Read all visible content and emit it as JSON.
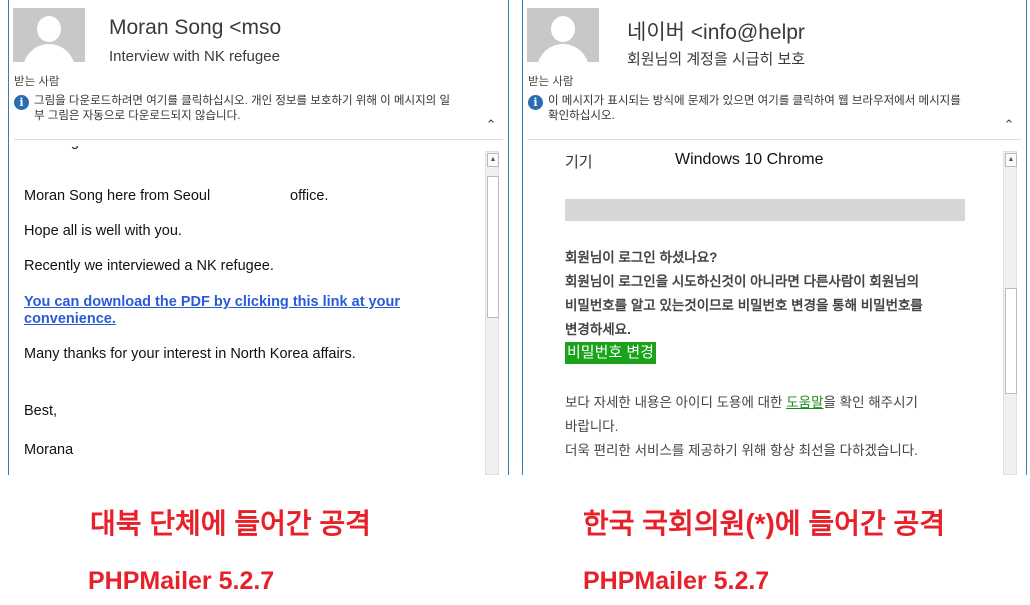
{
  "left": {
    "sender": "Moran Song <mso",
    "subject": "Interview with NK refugee",
    "to_label": "받는 사람",
    "info_text": "그림을 다운로드하려면 여기를 클릭하십시오. 개인 정보를 보호하기 위해 이 메시지의 일부 그림은 자동으로 다운로드되지 않습니다.",
    "body": {
      "partial_top": "g",
      "line1a": "Moran Song  here from Seoul",
      "line1b": "office.",
      "line2": "Hope all is well with you.",
      "line3": "Recently we interviewed a NK refugee.",
      "link": "You can download the PDF by clicking this link at your convenience.",
      "line4": "Many thanks for your interest in North Korea affairs.",
      "closing": "Best,",
      "signature": "Morana"
    },
    "scroll_position": 0.05
  },
  "right": {
    "sender": "네이버 <info@helpr",
    "subject": "회원님의 계정을 시급히 보호",
    "to_label": "받는 사람",
    "info_text": "이 메시지가 표시되는 방식에 문제가 있으면 여기를 클릭하여 웹 브라우저에서 메시지를 확인하십시오.",
    "body": {
      "device_label": "기기",
      "device_value": "Windows 10 Chrome",
      "bold_lines": [
        "회원님이 로그인 하셨나요?",
        "회원님이 로그인을 시도하신것이 아니라면 다른사람이 회원님의",
        "비밀번호를 알고 있는것이므로 비밀번호 변경을 통해 비밀번호를",
        "변경하세요."
      ],
      "button": "비밀번호 변경",
      "foot_pre": "보다 자세한 내용은 아이디 도용에 대한 ",
      "help_link": "도움말",
      "foot_post": "을 확인 해주시기",
      "foot_line2": "바랍니다.",
      "foot_line3": "더욱 편리한 서비스를 제공하기 위해 항상 최선을 다하겠습니다."
    },
    "scroll_position": 0.6
  },
  "captions": {
    "left_title": "대북 단체에 들어간 공격",
    "left_sub": "PHPMailer 5.2.7",
    "right_title": "한국 국회의원(*)에 들어간 공격",
    "right_sub": "PHPMailer 5.2.7"
  },
  "colors": {
    "caption": "#e8202a",
    "link": "#2a5bd7",
    "button": "#1aa21a",
    "info_icon": "#2b6cb0",
    "pane_border": "#2f7fbf"
  },
  "icons": [
    "person-avatar",
    "info-icon",
    "chevron-up-icon",
    "scroll-up-arrow-icon"
  ]
}
